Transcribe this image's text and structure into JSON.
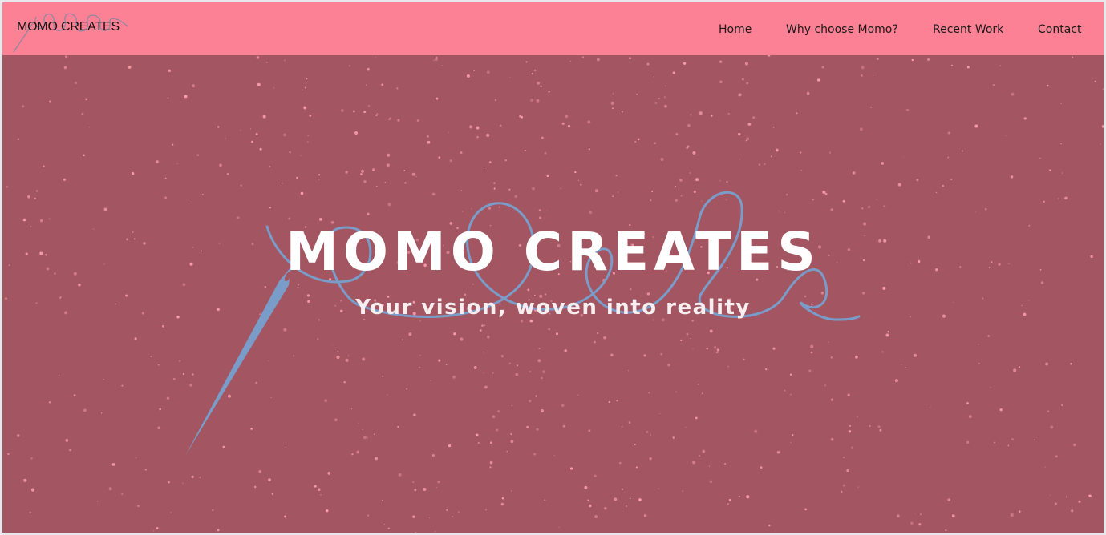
{
  "header": {
    "brand": "MOMO CREATES",
    "nav": [
      {
        "label": "Home"
      },
      {
        "label": "Why choose Momo?"
      },
      {
        "label": "Recent Work"
      },
      {
        "label": "Contact"
      }
    ]
  },
  "hero": {
    "title": "MOMO CREATES",
    "subtitle": "Your vision, woven into reality",
    "illustration": "needle-and-thread-icon"
  },
  "colors": {
    "navbar_bg": "#fd8194",
    "hero_bg": "#a35662",
    "speckles": "#ff9fae",
    "thread": "#7a9cc8",
    "text_light": "#ffffff",
    "text_dark": "#141414"
  }
}
